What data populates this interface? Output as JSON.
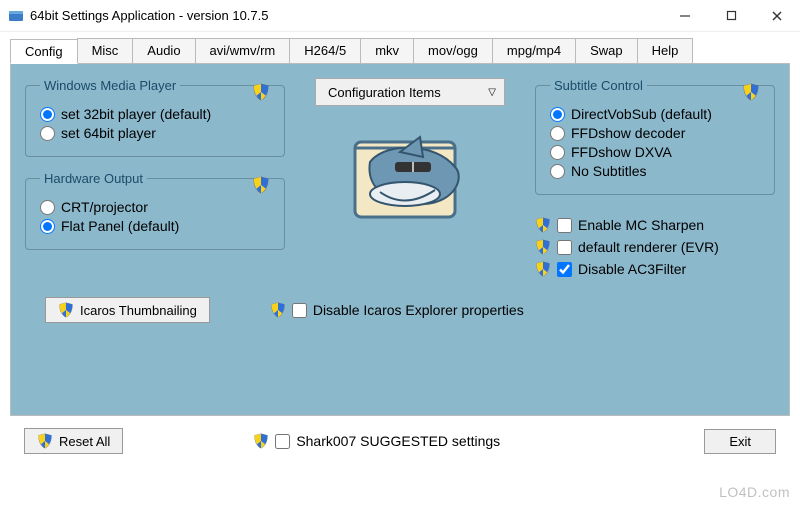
{
  "window": {
    "title": "64bit Settings Application - version 10.7.5"
  },
  "tabs": [
    "Config",
    "Misc",
    "Audio",
    "avi/wmv/rm",
    "H264/5",
    "mkv",
    "mov/ogg",
    "mpg/mp4",
    "Swap",
    "Help"
  ],
  "wmp": {
    "legend": "Windows Media Player",
    "opt32": "set 32bit player (default)",
    "opt64": "set 64bit player"
  },
  "hw": {
    "legend": "Hardware Output",
    "crt": "CRT/projector",
    "flat": "Flat Panel (default)"
  },
  "dropdown": {
    "label": "Configuration Items"
  },
  "subtitle": {
    "legend": "Subtitle Control",
    "dvs": "DirectVobSub (default)",
    "ffd": "FFDshow decoder",
    "dxva": "FFDshow DXVA",
    "none": "No Subtitles"
  },
  "checks": {
    "mcsharpen": "Enable MC Sharpen",
    "evr": "default renderer (EVR)",
    "ac3": "Disable AC3Filter"
  },
  "icaros_btn": "Icaros Thumbnailing",
  "icaros_check": "Disable Icaros Explorer properties",
  "reset_btn": "Reset All",
  "suggested": "Shark007 SUGGESTED settings",
  "exit_btn": "Exit",
  "watermark": "LO4D.com"
}
